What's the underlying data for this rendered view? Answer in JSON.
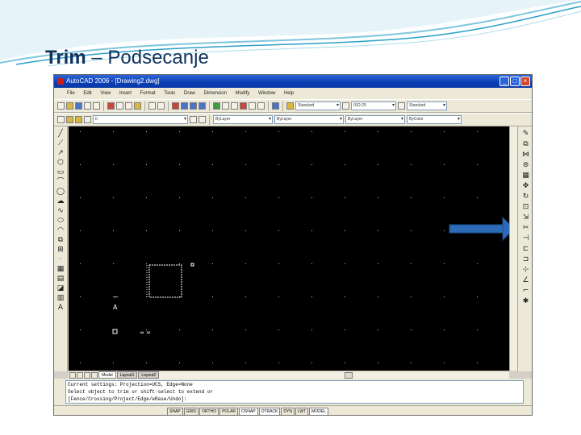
{
  "slide": {
    "title_bold": "Trim",
    "title_rest": " – Podsecanje"
  },
  "window": {
    "title": "AutoCAD 2006 - [Drawing2.dwg]",
    "buttons": [
      "_",
      "□",
      "×"
    ]
  },
  "menu": [
    "File",
    "Edit",
    "View",
    "Insert",
    "Format",
    "Tools",
    "Draw",
    "Dimension",
    "Modify",
    "Window",
    "Help"
  ],
  "toolbar": {
    "text_style": "Standard",
    "dim_style": "ISO-25",
    "table_style": "Standard",
    "layer": "0",
    "color": "ByLayer",
    "linetype": "ByLayer",
    "lineweight": "ByLayer",
    "plot_style": "ByColor"
  },
  "layout_tabs": [
    "Model",
    "Layout1",
    "Layout2"
  ],
  "command": {
    "lines": [
      "Current settings: Projection=UCS, Edge=None",
      "Select object to trim or shift-select to extend or",
      "[Fence/Crossing/Project/Edge/eRase/Undo]:"
    ]
  },
  "status": {
    "coords": "",
    "buttons": [
      "SNAP",
      "GRID",
      "ORTHO",
      "POLAR",
      "OSNAP",
      "OTRACK",
      "DYN",
      "LWT",
      "MODEL"
    ],
    "active": [
      "OSNAP",
      "OTRACK",
      "MODEL"
    ]
  },
  "colors": {
    "canvas": "#000000",
    "pointer_arrow": "#2d6bb8",
    "title_blue": "#10325a"
  },
  "icons": {
    "draw_tools": [
      "line-icon",
      "construction-line-icon",
      "polyline-icon",
      "polygon-icon",
      "rectangle-icon",
      "arc-icon",
      "circle-icon",
      "revision-cloud-icon",
      "spline-icon",
      "ellipse-icon",
      "ellipse-arc-icon",
      "insert-block-icon",
      "make-block-icon",
      "point-icon",
      "hatch-icon",
      "gradient-icon",
      "region-icon",
      "table-icon",
      "multiline-text-icon"
    ],
    "modify_tools": [
      "erase-icon",
      "copy-icon",
      "mirror-icon",
      "offset-icon",
      "array-icon",
      "move-icon",
      "rotate-icon",
      "scale-icon",
      "stretch-icon",
      "trim-icon",
      "extend-icon",
      "break-at-point-icon",
      "break-icon",
      "join-icon",
      "chamfer-icon",
      "fillet-icon",
      "explode-icon"
    ]
  }
}
